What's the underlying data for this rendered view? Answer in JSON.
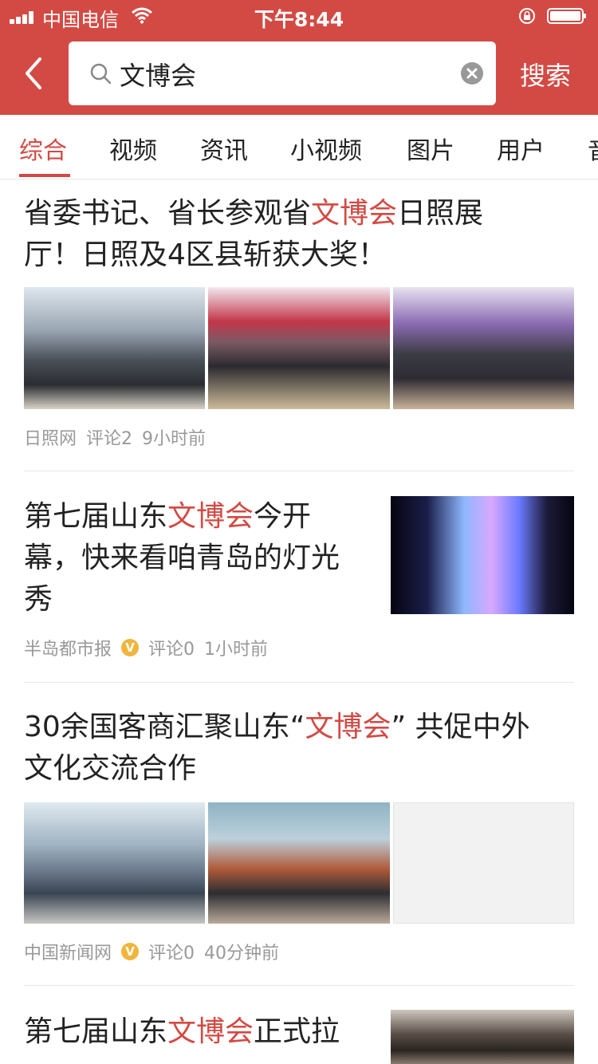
{
  "status_bar": {
    "carrier": "中国电信",
    "time": "下午8:44"
  },
  "header": {
    "back_icon": "chevron-left-icon",
    "search_icon": "search-icon",
    "query": "文博会",
    "clear_icon": "clear-circle-icon",
    "search_button": "搜索"
  },
  "tabs": [
    "综合",
    "视频",
    "资讯",
    "小视频",
    "图片",
    "用户",
    "音"
  ],
  "articles": [
    {
      "title_parts": [
        "省委书记、省长参观省",
        "文博会",
        "日照展"
      ],
      "title_line2": "厅！日照及4区县斩获大奖！",
      "source": "日照网",
      "comments": "评论2",
      "time": "9小时前"
    },
    {
      "title_parts": [
        "第七届山东",
        "文博会",
        "今开"
      ],
      "title_line2": "幕，快来看咱青岛的灯光",
      "title_line3": "秀",
      "source": "半岛都市报",
      "verified": "V",
      "comments": "评论0",
      "time": "1小时前"
    },
    {
      "title_parts": [
        "30余国客商汇聚山东“",
        "文博会",
        "” 共促中外"
      ],
      "title_line2": "文化交流合作",
      "source": "中国新闻网",
      "verified": "V",
      "comments": "评论0",
      "time": "40分钟前"
    },
    {
      "title_parts": [
        "第七届山东",
        "文博会",
        "正式拉"
      ]
    }
  ],
  "colors": {
    "accent": "#d34a44",
    "highlight": "#d34a44",
    "meta": "#999999",
    "verified_badge": "#f0b53c"
  }
}
